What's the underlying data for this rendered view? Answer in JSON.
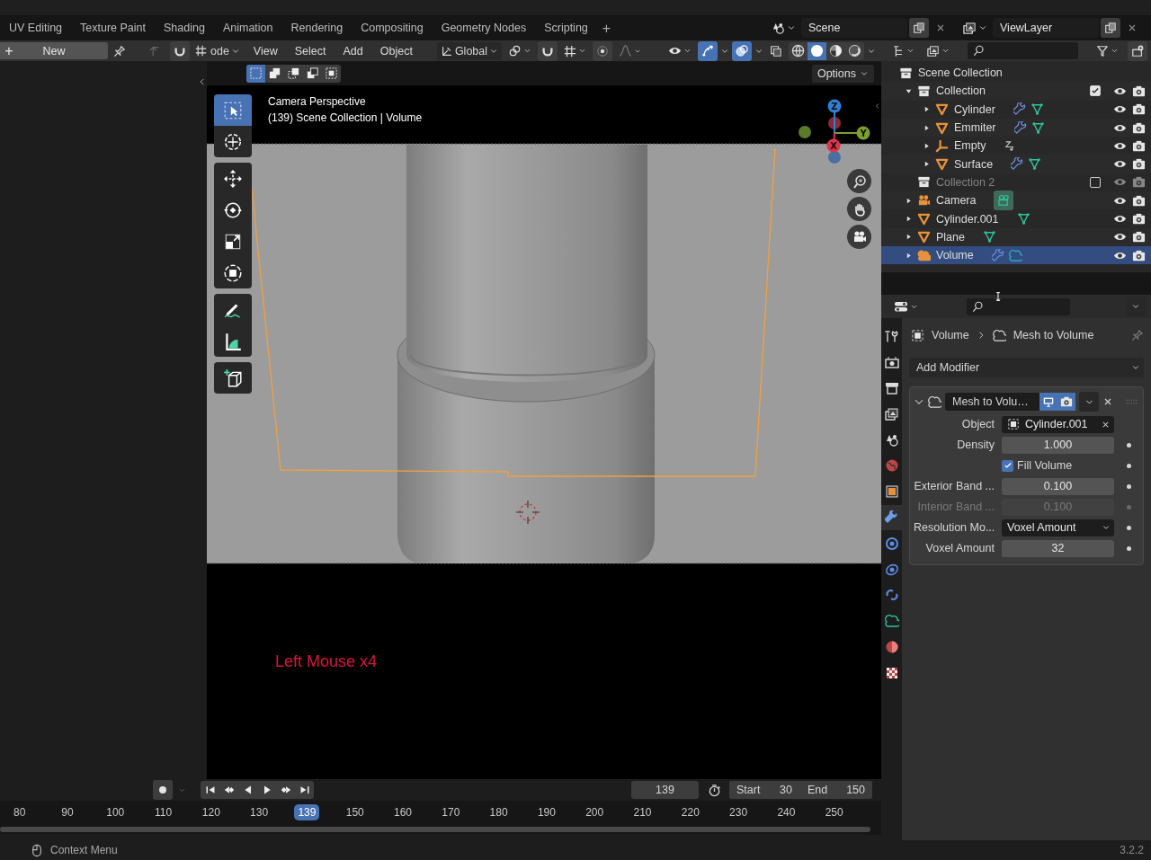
{
  "top_bar": {
    "tabs": [
      {
        "label": "UV Editing",
        "selected": false
      },
      {
        "label": "Texture Paint",
        "selected": false
      },
      {
        "label": "Shading",
        "selected": false
      },
      {
        "label": "Animation",
        "selected": false
      },
      {
        "label": "Rendering",
        "selected": false
      },
      {
        "label": "Compositing",
        "selected": false
      },
      {
        "label": "Geometry Nodes",
        "selected": false
      },
      {
        "label": "Scripting",
        "selected": false
      }
    ],
    "add_tab": "+",
    "scene": "Scene",
    "view_layer": "ViewLayer"
  },
  "left_panel": {
    "new_icon": "+",
    "new_button": "New"
  },
  "viewport": {
    "header": {
      "mode": "ode",
      "menus": [
        "View",
        "Select",
        "Add",
        "Object"
      ],
      "orientation": "Global",
      "gizmos_on": true,
      "overlays_on": true,
      "shading": [
        {
          "kind": "wireframe",
          "selected": false
        },
        {
          "kind": "solid",
          "selected": true
        },
        {
          "kind": "material",
          "selected": false
        },
        {
          "kind": "rendered",
          "selected": false
        }
      ]
    },
    "select_modes": [
      {
        "kind": "set",
        "selected": true
      },
      {
        "kind": "extend",
        "selected": false
      },
      {
        "kind": "subtract",
        "selected": false
      },
      {
        "kind": "invert",
        "selected": false
      },
      {
        "kind": "intersect",
        "selected": false
      }
    ],
    "options": "Options",
    "overlay_text": [
      "Camera Perspective",
      "(139) Scene Collection | Volume"
    ],
    "tools": [
      [
        {
          "kind": "select_box",
          "selected": true
        },
        {
          "kind": "cursor",
          "selected": false
        }
      ],
      [
        {
          "kind": "move",
          "selected": false
        },
        {
          "kind": "rotate",
          "selected": false
        },
        {
          "kind": "scale",
          "selected": false
        },
        {
          "kind": "transform",
          "selected": false
        }
      ],
      [
        {
          "kind": "annotate",
          "selected": false
        },
        {
          "kind": "measure",
          "selected": false
        }
      ],
      [
        {
          "kind": "add_cube",
          "selected": false
        }
      ]
    ],
    "axes": [
      {
        "label": "Z",
        "color": "#2f7fd8"
      },
      {
        "label": "Y",
        "color": "#7ca12a"
      },
      {
        "label": "X",
        "color": "#e0344c"
      }
    ],
    "key_hint": "Left Mouse x4"
  },
  "outliner": {
    "rows": [
      {
        "label": "Scene Collection",
        "kind": "scene_collection",
        "selected": false,
        "children": [
          {
            "label": "Collection",
            "kind": "collection",
            "expanded": true,
            "checked": true,
            "disabled": false,
            "selected": false,
            "children": [
              {
                "label": "Cylinder",
                "kind": "mesh",
                "expanded": false,
                "modifier": true,
                "constraint": false,
                "selected": false
              },
              {
                "label": "Emmiter",
                "kind": "mesh",
                "expanded": false,
                "modifier": true,
                "constraint": false,
                "selected": false
              },
              {
                "label": "Empty",
                "kind": "empty",
                "expanded": false,
                "modifier": false,
                "constraint": true,
                "selected": false
              },
              {
                "label": "Surface",
                "kind": "mesh",
                "expanded": false,
                "modifier": true,
                "constraint": false,
                "selected": false
              }
            ]
          },
          {
            "label": "Collection 2",
            "kind": "collection",
            "checked": false,
            "disabled": true,
            "selected": false
          },
          {
            "label": "Camera",
            "kind": "camera",
            "expanded": false,
            "modifier": false,
            "constraint": false,
            "selected": false
          },
          {
            "label": "Cylinder.001",
            "kind": "mesh",
            "expanded": false,
            "modifier": false,
            "constraint": false,
            "selected": false
          },
          {
            "label": "Plane",
            "kind": "mesh",
            "expanded": false,
            "modifier": false,
            "constraint": false,
            "selected": false
          },
          {
            "label": "Volume",
            "kind": "volume",
            "expanded": false,
            "modifier": true,
            "constraint": false,
            "selected": true
          }
        ]
      }
    ]
  },
  "properties": {
    "tabs": [
      {
        "kind": "tool",
        "selected": false
      },
      {
        "kind": "render",
        "selected": false
      },
      {
        "kind": "output",
        "selected": false
      },
      {
        "kind": "view_layer",
        "selected": false
      },
      {
        "kind": "scene",
        "selected": false
      },
      {
        "kind": "world",
        "selected": false
      },
      {
        "kind": "object",
        "selected": false
      },
      {
        "kind": "modifiers",
        "selected": true
      },
      {
        "kind": "particles",
        "selected": false
      },
      {
        "kind": "physics",
        "selected": false
      },
      {
        "kind": "constraints",
        "selected": false
      },
      {
        "kind": "data",
        "selected": false
      },
      {
        "kind": "material",
        "selected": false
      },
      {
        "kind": "texture",
        "selected": false
      }
    ],
    "breadcrumb": [
      "Volume",
      "Mesh to Volume"
    ],
    "add_modifier": "Add Modifier",
    "modifier": {
      "name": "Mesh to Volu…",
      "expanded": true,
      "show_viewport": true,
      "show_render": true,
      "properties": [
        {
          "kind": "object",
          "label": "Object",
          "value": "Cylinder.001",
          "disabled": false
        },
        {
          "kind": "number",
          "label": "Density",
          "value": "1.000",
          "disabled": false
        },
        {
          "kind": "checkbox",
          "label": "Fill Volume",
          "checked": true
        },
        {
          "kind": "number",
          "label": "Exterior Band ...",
          "value": "0.100",
          "disabled": false
        },
        {
          "kind": "number",
          "label": "Interior Band ...",
          "value": "0.100",
          "disabled": true
        },
        {
          "kind": "dropdown",
          "label": "Resolution Mo...",
          "value": "Voxel Amount",
          "disabled": false
        },
        {
          "kind": "number",
          "label": "Voxel Amount",
          "value": "32",
          "disabled": false
        }
      ]
    }
  },
  "timeline": {
    "auto_keying": false,
    "frame": "139",
    "start_label": "Start",
    "start": "30",
    "end_label": "End",
    "end": "150",
    "ruler": [
      {
        "label": "80",
        "selected": false
      },
      {
        "label": "90",
        "selected": false
      },
      {
        "label": "100",
        "selected": false
      },
      {
        "label": "110",
        "selected": false
      },
      {
        "label": "120",
        "selected": false
      },
      {
        "label": "130",
        "selected": false
      },
      {
        "label": "139",
        "selected": true
      },
      {
        "label": "150",
        "selected": false
      },
      {
        "label": "160",
        "selected": false
      },
      {
        "label": "170",
        "selected": false
      },
      {
        "label": "180",
        "selected": false
      },
      {
        "label": "190",
        "selected": false
      },
      {
        "label": "200",
        "selected": false
      },
      {
        "label": "210",
        "selected": false
      },
      {
        "label": "220",
        "selected": false
      },
      {
        "label": "230",
        "selected": false
      },
      {
        "label": "240",
        "selected": false
      },
      {
        "label": "250",
        "selected": false
      }
    ]
  },
  "status_bar": {
    "hint": "Context Menu",
    "version": "3.2.2"
  }
}
